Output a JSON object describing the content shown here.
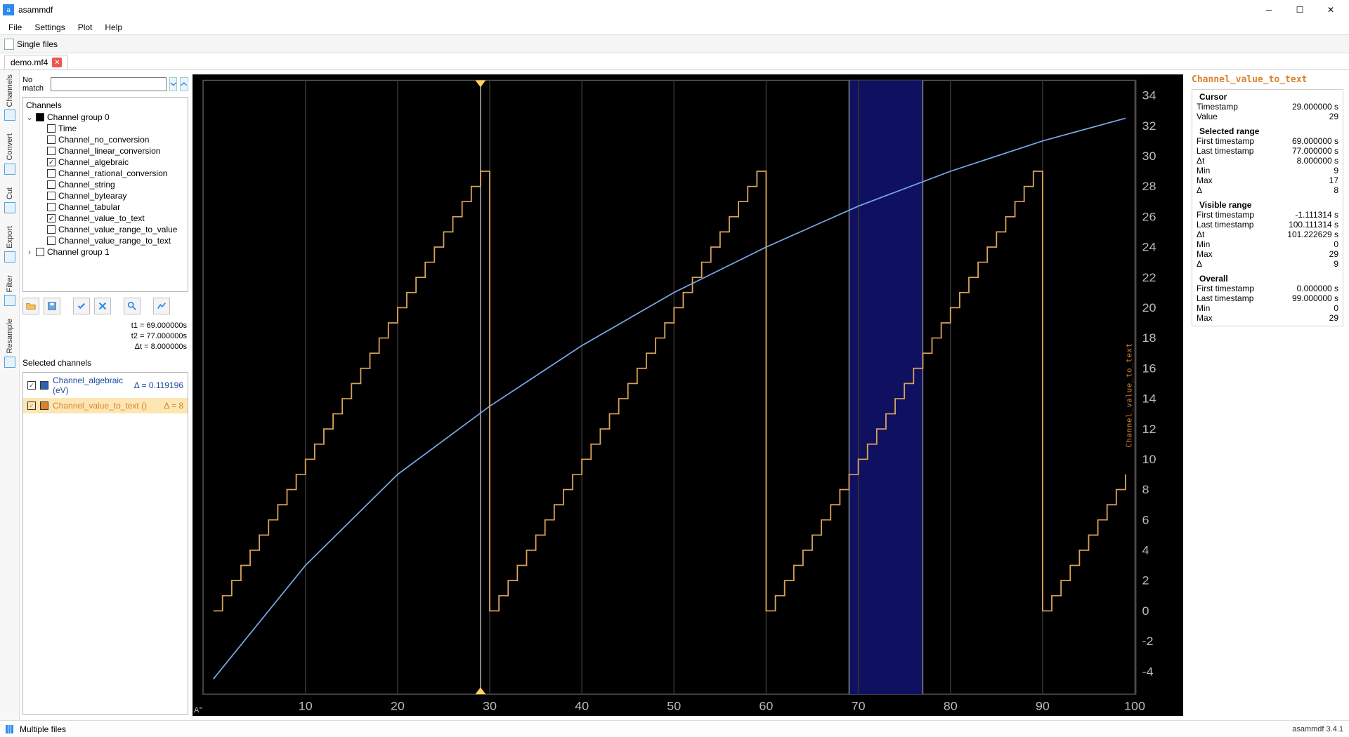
{
  "window": {
    "title": "asammdf"
  },
  "menu": [
    "File",
    "Settings",
    "Plot",
    "Help"
  ],
  "modebar": {
    "label": "Single files"
  },
  "file_tab": {
    "name": "demo.mf4"
  },
  "vstrip": [
    "Channels",
    "Convert",
    "Cut",
    "Export",
    "Filter",
    "Resample"
  ],
  "search": {
    "label": "No match",
    "value": ""
  },
  "tree": {
    "header": "Channels",
    "group0": {
      "label": "Channel group 0",
      "items": [
        {
          "label": "Time",
          "checked": false
        },
        {
          "label": "Channel_no_conversion",
          "checked": false
        },
        {
          "label": "Channel_linear_conversion",
          "checked": false
        },
        {
          "label": "Channel_algebraic",
          "checked": true
        },
        {
          "label": "Channel_rational_conversion",
          "checked": false
        },
        {
          "label": "Channel_string",
          "checked": false
        },
        {
          "label": "Channel_bytearay",
          "checked": false
        },
        {
          "label": "Channel_tabular",
          "checked": false
        },
        {
          "label": "Channel_value_to_text",
          "checked": true
        },
        {
          "label": "Channel_value_range_to_value",
          "checked": false
        },
        {
          "label": "Channel_value_range_to_text",
          "checked": false
        }
      ]
    },
    "group1": {
      "label": "Channel group 1"
    }
  },
  "tvals": {
    "t1": "t1 = 69.000000s",
    "t2": "t2 = 77.000000s",
    "dt": "Δt = 8.000000s"
  },
  "selected_header": "Selected channels",
  "selected": [
    {
      "name": "Channel_algebraic (eV)",
      "delta": "Δ = 0.119196",
      "color": "#2d5fb3"
    },
    {
      "name": "Channel_value_to_text ()",
      "delta": "Δ = 8",
      "color": "#d9822b"
    }
  ],
  "stats": {
    "channel": "Channel_value_to_text",
    "cursor": {
      "hdr": "Cursor",
      "Timestamp": "29.000000 s",
      "Value": "29"
    },
    "selrange": {
      "hdr": "Selected range",
      "First timestamp": "69.000000 s",
      "Last timestamp": "77.000000 s",
      "Δt": "8.000000 s",
      "Min": "9",
      "Max": "17",
      "Δ": "8"
    },
    "visrange": {
      "hdr": "Visible range",
      "First timestamp": "-1.111314 s",
      "Last timestamp": "100.111314 s",
      "Δt": "101.222629 s",
      "Min": "0",
      "Max": "29",
      "Δ": "9"
    },
    "overall": {
      "hdr": "Overall",
      "First timestamp": "0.000000 s",
      "Last timestamp": "99.000000 s",
      "Min": "0",
      "Max": "29"
    }
  },
  "status": {
    "left": "Multiple files",
    "right": "asammdf 3.4.1"
  },
  "plot_corner": "A°",
  "chart_data": {
    "type": "line",
    "xlabel": "",
    "ylabel": "Channel_value_to_text",
    "x_range": [
      -1.111314,
      100.111314
    ],
    "y_range": [
      -5.5,
      35
    ],
    "x_ticks": [
      10,
      20,
      30,
      40,
      50,
      60,
      70,
      80,
      90,
      100
    ],
    "y_ticks": [
      -4,
      -2,
      0,
      2,
      4,
      6,
      8,
      10,
      12,
      14,
      16,
      18,
      20,
      22,
      24,
      26,
      28,
      30,
      32,
      34
    ],
    "cursor_x": 29,
    "selection_x": [
      69,
      77
    ],
    "series": [
      {
        "name": "Channel_algebraic (eV)",
        "color": "#7aa7e8",
        "style": "curve",
        "x": [
          0,
          10,
          20,
          30,
          40,
          50,
          60,
          70,
          80,
          90,
          99
        ],
        "y": [
          -4.5,
          3,
          9,
          13.5,
          17.5,
          21,
          24,
          26.7,
          29,
          31,
          32.5
        ]
      },
      {
        "name": "Channel_value_to_text ()",
        "color": "#d9a35a",
        "style": "step",
        "period": 30,
        "x": [
          0,
          1,
          2,
          3,
          4,
          5,
          6,
          7,
          8,
          9,
          10,
          11,
          12,
          13,
          14,
          15,
          16,
          17,
          18,
          19,
          20,
          21,
          22,
          23,
          24,
          25,
          26,
          27,
          28,
          29,
          30,
          31,
          32,
          33,
          34,
          35,
          36,
          37,
          38,
          39,
          40,
          41,
          42,
          43,
          44,
          45,
          46,
          47,
          48,
          49,
          50,
          51,
          52,
          53,
          54,
          55,
          56,
          57,
          58,
          59,
          60,
          61,
          62,
          63,
          64,
          65,
          66,
          67,
          68,
          69,
          70,
          71,
          72,
          73,
          74,
          75,
          76,
          77,
          78,
          79,
          80,
          81,
          82,
          83,
          84,
          85,
          86,
          87,
          88,
          89,
          90,
          91,
          92,
          93,
          94,
          95,
          96,
          97,
          98,
          99
        ],
        "y": [
          0,
          1,
          2,
          3,
          4,
          5,
          6,
          7,
          8,
          9,
          10,
          11,
          12,
          13,
          14,
          15,
          16,
          17,
          18,
          19,
          20,
          21,
          22,
          23,
          24,
          25,
          26,
          27,
          28,
          29,
          0,
          1,
          2,
          3,
          4,
          5,
          6,
          7,
          8,
          9,
          10,
          11,
          12,
          13,
          14,
          15,
          16,
          17,
          18,
          19,
          20,
          21,
          22,
          23,
          24,
          25,
          26,
          27,
          28,
          29,
          0,
          1,
          2,
          3,
          4,
          5,
          6,
          7,
          8,
          9,
          10,
          11,
          12,
          13,
          14,
          15,
          16,
          17,
          18,
          19,
          20,
          21,
          22,
          23,
          24,
          25,
          26,
          27,
          28,
          29,
          0,
          1,
          2,
          3,
          4,
          5,
          6,
          7,
          8,
          9
        ]
      }
    ]
  }
}
